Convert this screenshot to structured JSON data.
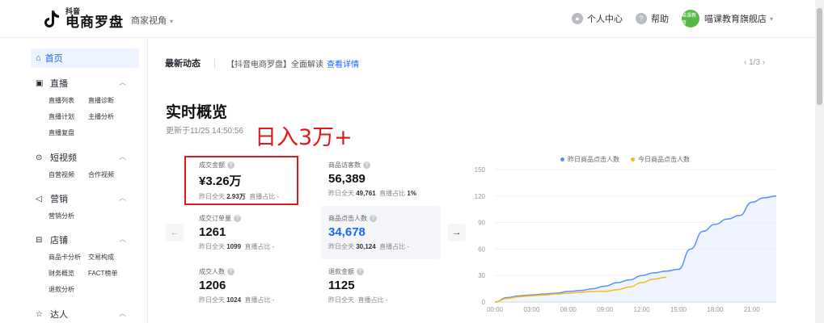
{
  "header": {
    "logo_small": "抖音",
    "logo_big": "电商罗盘",
    "view_switch": "商家视角",
    "personal_center": "个人中心",
    "help": "帮助",
    "avatar_text": "喵课教育",
    "shop_name": "喵课教育旗舰店"
  },
  "sidebar": {
    "home": "首页",
    "sections": [
      {
        "title": "直播",
        "items": [
          "直播列表",
          "直播诊断",
          "直播计划",
          "主播分析",
          "直播复盘"
        ]
      },
      {
        "title": "短视频",
        "items": [
          "自营视频",
          "合作视频"
        ]
      },
      {
        "title": "营销",
        "items": [
          "营销分析"
        ]
      },
      {
        "title": "店铺",
        "items": [
          "商品卡分析",
          "交易构成",
          "财务概览",
          "FACT榜单",
          "退款分析"
        ]
      },
      {
        "title": "达人",
        "items": []
      }
    ]
  },
  "news": {
    "title": "最新动态",
    "text": "【抖音电商罗盘】全面解读",
    "link": "查看详情",
    "pager": "1/3"
  },
  "realtime": {
    "title": "实时概览",
    "updated": "更新于11/25 14:50:56",
    "annotation": "日入3万+",
    "metrics": [
      {
        "label": "成交金额",
        "value": "¥3.26万",
        "sub_prefix": "昨日全天",
        "sub_value": "2.93万",
        "sub_suffix": "直播占比"
      },
      {
        "label": "商品访客数",
        "value": "56,389",
        "sub_prefix": "昨日全天",
        "sub_value": "49,761",
        "sub_suffix": "直播占比",
        "sub_pct": "1%"
      },
      {
        "label": "成交订单量",
        "value": "1261",
        "sub_prefix": "昨日全天",
        "sub_value": "1099",
        "sub_suffix": "直播占比"
      },
      {
        "label": "商品点击人数",
        "value": "34,678",
        "sub_prefix": "昨日全天",
        "sub_value": "30,124",
        "sub_suffix": "直播占比"
      },
      {
        "label": "成交人数",
        "value": "1206",
        "sub_prefix": "昨日全天",
        "sub_value": "1024",
        "sub_suffix": "直播占比"
      },
      {
        "label": "退款金额",
        "value": "1125",
        "sub_prefix": "昨日全天",
        "sub_value": "",
        "sub_suffix": "直播占比"
      }
    ]
  },
  "colors": {
    "accent": "#1966ff",
    "yesterday": "#5b8ff9",
    "today": "#f6bd16",
    "annotation": "#e01a1a"
  },
  "chart_data": {
    "type": "line",
    "x": [
      "00:00",
      "01:00",
      "02:00",
      "03:00",
      "04:00",
      "05:00",
      "06:00",
      "07:00",
      "08:00",
      "09:00",
      "10:00",
      "11:00",
      "12:00",
      "13:00",
      "14:00",
      "15:00",
      "16:00",
      "17:00",
      "18:00",
      "19:00",
      "20:00",
      "21:00",
      "22:00",
      "23:00"
    ],
    "x_tick_labels": [
      "00:00",
      "03:00",
      "06:00",
      "09:00",
      "12:00",
      "15:00",
      "18:00",
      "21:00"
    ],
    "ylim": [
      0,
      150
    ],
    "y_ticks": [
      0,
      30,
      60,
      90,
      120,
      150
    ],
    "series": [
      {
        "name": "昨日商品点击人数",
        "values": [
          0,
          5,
          7,
          8,
          9,
          10,
          12,
          13,
          15,
          18,
          22,
          25,
          30,
          33,
          35,
          37,
          60,
          80,
          88,
          94,
          98,
          113,
          118,
          120
        ]
      },
      {
        "name": "今日商品点击人数",
        "values": [
          0,
          4,
          6,
          7,
          8,
          9,
          10,
          11,
          12,
          12,
          14,
          17,
          22,
          26,
          28
        ]
      }
    ],
    "legend": "top"
  }
}
